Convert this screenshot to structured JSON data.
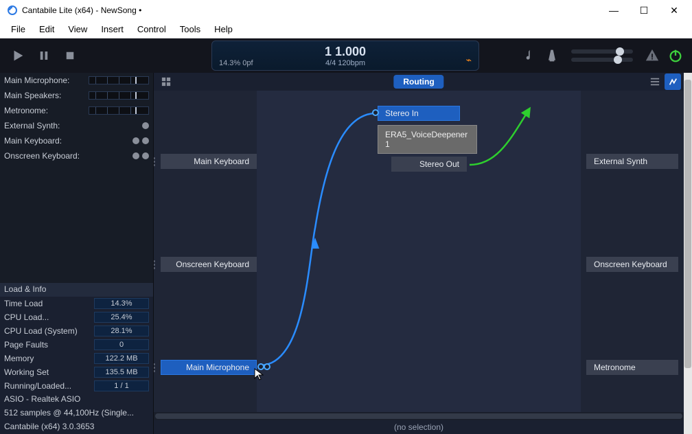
{
  "window": {
    "title": "Cantabile Lite (x64) - NewSong •"
  },
  "menu": {
    "file": "File",
    "edit": "Edit",
    "view": "View",
    "insert": "Insert",
    "control": "Control",
    "tools": "Tools",
    "help": "Help"
  },
  "transport": {
    "position": "1 1.000",
    "tempo": "4/4 120bpm",
    "load": "14.3%  0pf"
  },
  "ports": [
    {
      "label": "Main Microphone:",
      "type": "meter"
    },
    {
      "label": "Main Speakers:",
      "type": "meter"
    },
    {
      "label": "Metronome:",
      "type": "meter"
    },
    {
      "label": "External Synth:",
      "type": "dot1"
    },
    {
      "label": "Main Keyboard:",
      "type": "dot2"
    },
    {
      "label": "Onscreen Keyboard:",
      "type": "dot2"
    }
  ],
  "loadinfo": {
    "header": "Load & Info",
    "rows": [
      {
        "k": "Time Load",
        "v": "14.3%"
      },
      {
        "k": "CPU Load...",
        "v": "25.4%"
      },
      {
        "k": "CPU Load (System)",
        "v": "28.1%"
      },
      {
        "k": "Page Faults",
        "v": "0"
      },
      {
        "k": "Memory",
        "v": "122.2 MB"
      },
      {
        "k": "Working Set",
        "v": "135.5 MB"
      },
      {
        "k": "Running/Loaded...",
        "v": "1 / 1"
      }
    ],
    "lines": [
      "ASIO - Realtek ASIO",
      "512 samples @ 44,100Hz (Single...",
      "Cantabile (x64) 3.0.3653"
    ]
  },
  "routing": {
    "tab": "Routing",
    "nodes": {
      "main_keyboard": "Main Keyboard",
      "onscreen_keyboard": "Onscreen Keyboard",
      "main_microphone": "Main Microphone",
      "stereo_in": "Stereo In",
      "stereo_out": "Stereo Out",
      "plugin": "ERA5_VoiceDeepener 1",
      "external_synth": "External Synth",
      "onscreen_keyboard_r": "Onscreen Keyboard",
      "metronome": "Metronome"
    }
  },
  "status": {
    "selection": "(no selection)"
  }
}
